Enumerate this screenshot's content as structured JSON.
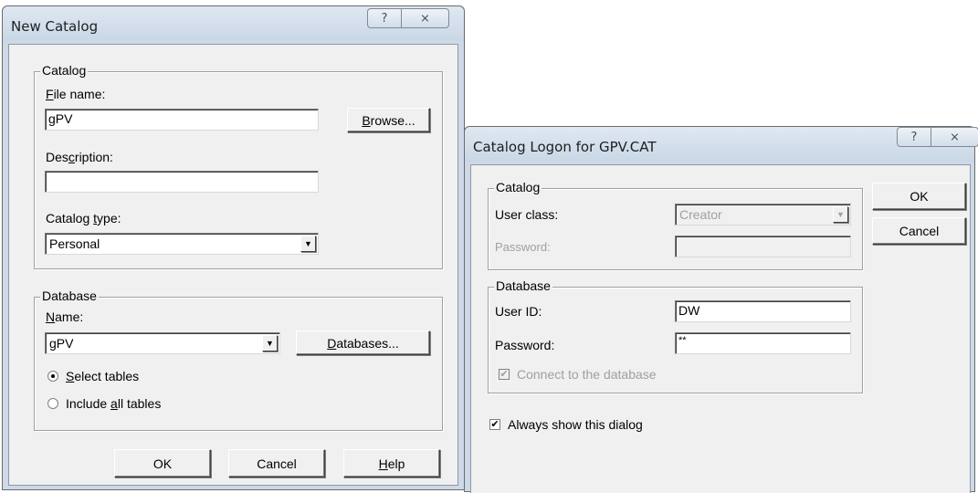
{
  "new_catalog": {
    "title": "New Catalog",
    "help_glyph": "?",
    "close_glyph": "⨯",
    "catalog_group": "Catalog",
    "file_name_label_key": "F",
    "file_name_label_rest": "ile name:",
    "file_name_value": "gPV",
    "browse_label_key": "B",
    "browse_label_rest": "rowse...",
    "description_label_pre": "Des",
    "description_label_key": "c",
    "description_label_post": "ription:",
    "description_value": "",
    "catalog_type_label_pre": "Catalog ",
    "catalog_type_label_key": "t",
    "catalog_type_label_post": "ype:",
    "catalog_type_value": "Personal",
    "database_group": "Database",
    "name_label_key": "N",
    "name_label_rest": "ame:",
    "name_value": "gPV",
    "databases_label_key": "D",
    "databases_label_rest": "atabases...",
    "select_tables_key": "S",
    "select_tables_rest": "elect tables",
    "include_all_pre": "Include ",
    "include_all_key": "a",
    "include_all_post": "ll tables",
    "ok_label": "OK",
    "cancel_label": "Cancel",
    "help_label_key": "H",
    "help_label_rest": "elp"
  },
  "catalog_logon": {
    "title": "Catalog Logon for GPV.CAT",
    "help_glyph": "?",
    "close_glyph": "⨯",
    "catalog_group": "Catalog",
    "user_class_label": "User class:",
    "user_class_value": "Creator",
    "password_label": "Password:",
    "password_value": "",
    "database_group": "Database",
    "user_id_label": "User ID:",
    "user_id_value": "DW",
    "db_password_label": "Password:",
    "db_password_value": "**",
    "connect_label": "Connect to the database",
    "always_show_label": "Always show this dialog",
    "ok_label": "OK",
    "cancel_label": "Cancel"
  }
}
